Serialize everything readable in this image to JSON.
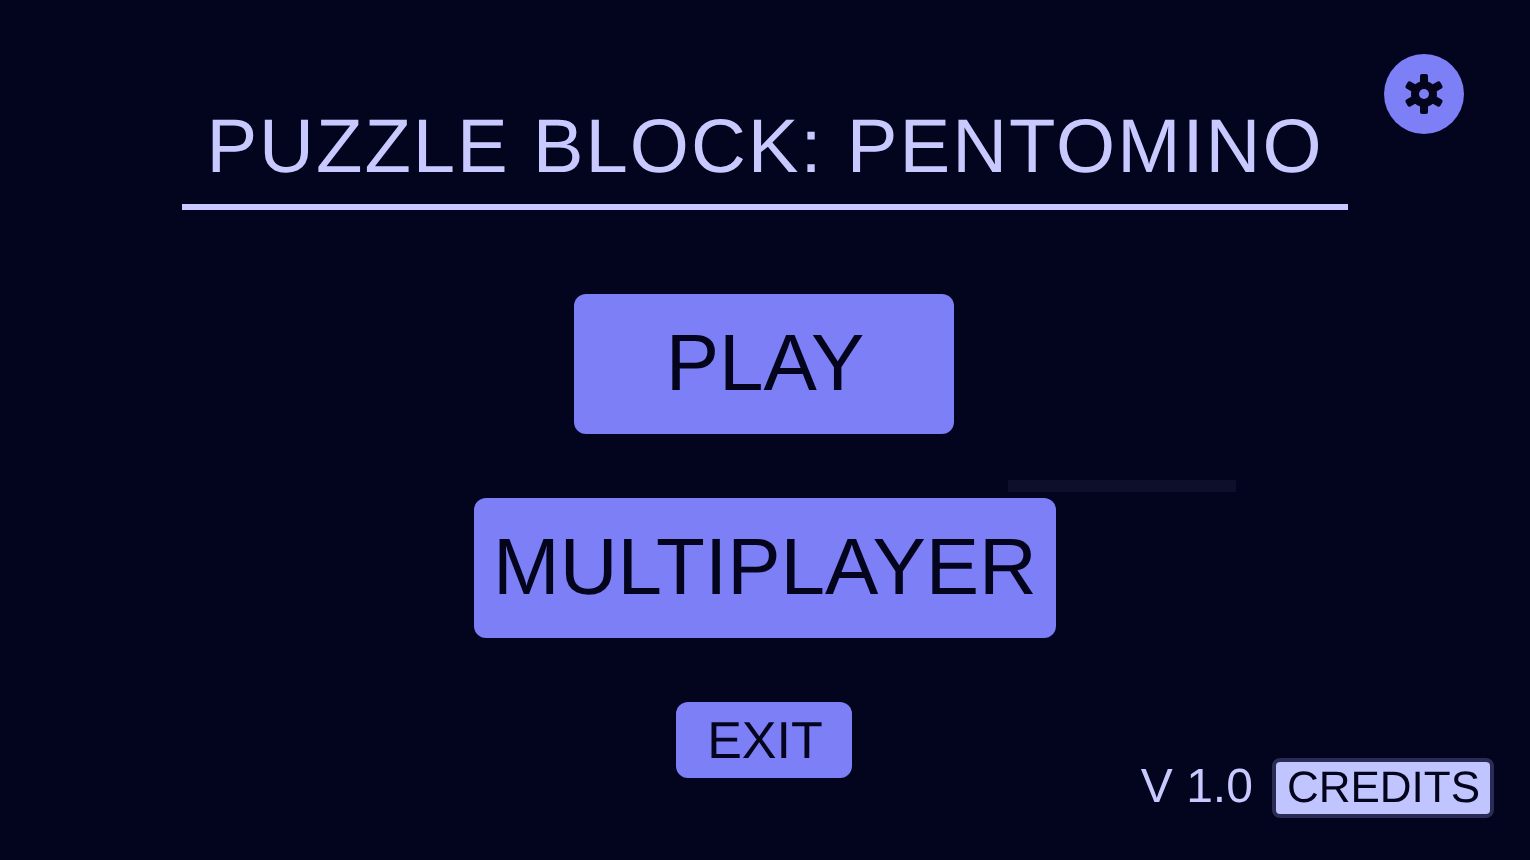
{
  "title": "PUZZLE BLOCK: PENTOMINO",
  "menu": [
    {
      "label": "PLAY",
      "kind": "main"
    },
    {
      "label": "MULTIPLAYER",
      "kind": "main"
    },
    {
      "label": "EXIT",
      "kind": "minor"
    }
  ],
  "version": "V 1.0",
  "credits_button": "CREDITS"
}
